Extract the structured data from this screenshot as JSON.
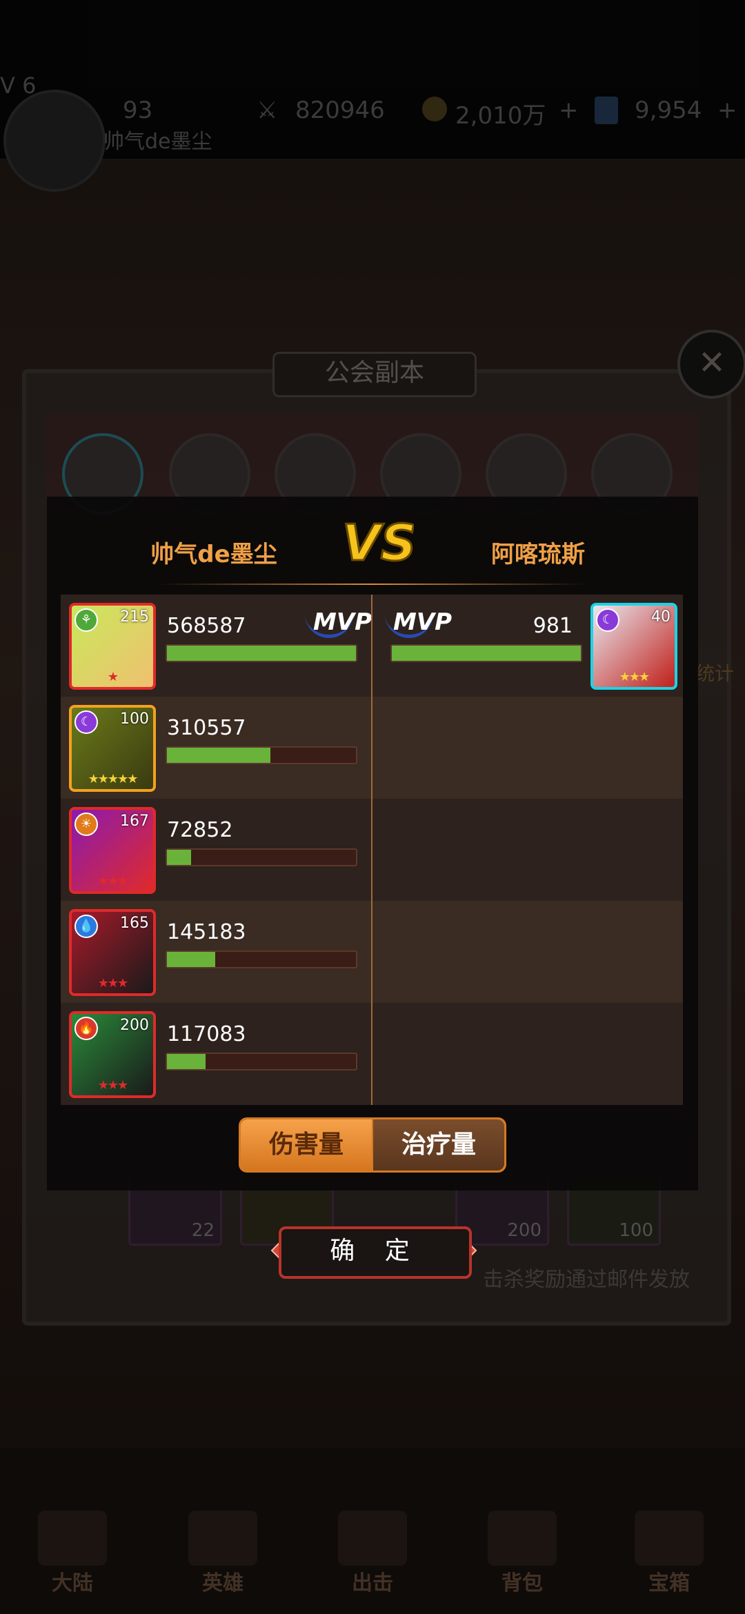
{
  "top_bar": {
    "level": "V 6",
    "player_name": "帅气de墨尘",
    "stamina": "93",
    "power": "820946",
    "gold": "2,010万",
    "gems": "9,954"
  },
  "guild_dialog": {
    "title": "公会副本",
    "footer_note": "击杀奖励通过邮件发放",
    "side_label": "统计",
    "rewards": [
      "22",
      "200",
      "100"
    ]
  },
  "battle_result": {
    "left_team": "帅气de墨尘",
    "right_team": "阿喀琉斯",
    "vs_label": "VS",
    "mvp_label": "MVP",
    "left_heroes": [
      {
        "level": "215",
        "element": "wind",
        "stars": "★",
        "frame_color": "#e02a2a",
        "damage": "568587",
        "ratio": 1.0,
        "mvp": true
      },
      {
        "level": "100",
        "element": "moon",
        "stars": "★★★★★",
        "frame_color": "#f2a21f",
        "damage": "310557",
        "ratio": 0.546,
        "mvp": false
      },
      {
        "level": "167",
        "element": "sun",
        "stars": "★★★",
        "frame_color": "#e02a2a",
        "damage": "72852",
        "ratio": 0.128,
        "mvp": false
      },
      {
        "level": "165",
        "element": "water",
        "stars": "★★★",
        "frame_color": "#e02a2a",
        "damage": "145183",
        "ratio": 0.255,
        "mvp": false
      },
      {
        "level": "200",
        "element": "fire",
        "stars": "★★★",
        "frame_color": "#e02a2a",
        "damage": "117083",
        "ratio": 0.206,
        "mvp": false
      }
    ],
    "right_heroes": [
      {
        "level": "40",
        "element": "moon",
        "stars": "★★★",
        "frame_color": "#1cd3e6",
        "damage": "981",
        "ratio": 1.0,
        "mvp": true
      }
    ],
    "tabs": {
      "damage": "伤害量",
      "heal": "治疗量"
    },
    "confirm": "确 定"
  },
  "bottom_nav": [
    "大陆",
    "英雄",
    "出击",
    "背包",
    "宝箱"
  ]
}
